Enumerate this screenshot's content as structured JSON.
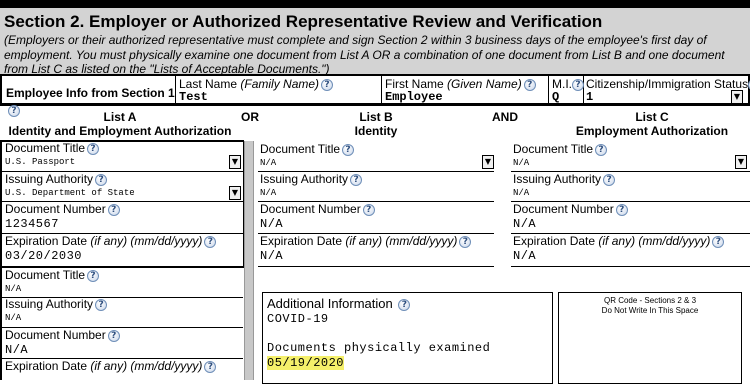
{
  "section": {
    "title": "Section 2. Employer or Authorized Representative Review and Verification",
    "desc": "(Employers or their authorized representative must complete and sign Section 2 within 3 business days of the employee's first day of employment. You must physically examine one document from List A OR a combination of one document from List B and one document from List C as listed on the \"Lists of Acceptable Documents.\")"
  },
  "employee": {
    "row_label": "Employee Info from Section 1",
    "last_name_label": "Last Name",
    "last_name_hint": "(Family Name)",
    "last_name": "Test",
    "first_name_label": "First Name",
    "first_name_hint": "(Given Name)",
    "first_name": "Employee",
    "mi_label": "M.I.",
    "mi": "Q",
    "status_label": "Citizenship/Immigration Status",
    "status": "1"
  },
  "lists": {
    "a_title": "List A",
    "a_sub": "Identity and Employment Authorization",
    "or": "OR",
    "b_title": "List B",
    "b_sub": "Identity",
    "and": "AND",
    "c_title": "List C",
    "c_sub": "Employment Authorization"
  },
  "labels": {
    "doc_title": "Document Title",
    "issuing": "Issuing Authority",
    "doc_number": "Document Number",
    "exp_main": "Expiration Date",
    "exp_hint": "(if any) (mm/dd/yyyy)"
  },
  "list_a": {
    "doc_title": "U.S. Passport",
    "issuing": "U.S. Department of State",
    "doc_number": "1234567",
    "expiration": "03/20/2030"
  },
  "list_a2": {
    "doc_title": "N/A",
    "issuing": "N/A",
    "doc_number": "N/A"
  },
  "list_b": {
    "doc_title": "N/A",
    "issuing": "N/A",
    "doc_number": "N/A",
    "expiration": "N/A"
  },
  "list_c": {
    "doc_title": "N/A",
    "issuing": "N/A",
    "doc_number": "N/A",
    "expiration": "N/A"
  },
  "additional": {
    "title": "Additional Information",
    "line1": "COVID-19",
    "line2": "Documents physically examined",
    "date": "05/19/2020"
  },
  "qr": {
    "line1": "QR Code - Sections 2 & 3",
    "line2": "Do Not Write In This Space"
  },
  "icons": {
    "help": "question-mark-circle-icon",
    "dropdown": "chevron-down-icon"
  },
  "colors": {
    "header_bg": "#d3d3d3",
    "highlight": "#f5f06a"
  }
}
